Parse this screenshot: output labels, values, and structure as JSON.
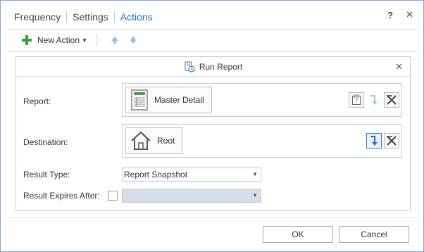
{
  "tabs": [
    {
      "label": "Frequency",
      "active": false
    },
    {
      "label": "Settings",
      "active": false
    },
    {
      "label": "Actions",
      "active": true
    }
  ],
  "title_controls": {
    "help": "?",
    "close": "✕"
  },
  "toolbar": {
    "new_action_label": "New Action"
  },
  "panel": {
    "title": "Run Report",
    "close": "✕",
    "report": {
      "label": "Report:",
      "value": "Master Detail"
    },
    "destination": {
      "label": "Destination:",
      "value": "Root"
    },
    "result_type": {
      "label": "Result Type:",
      "value": "Report Snapshot"
    },
    "result_expires": {
      "label": "Result Expires After:",
      "checked": false,
      "value": ""
    }
  },
  "footer": {
    "ok_label": "OK",
    "cancel_label": "Cancel"
  },
  "colors": {
    "accent": "#1f6fb4",
    "add_green": "#3e9a3e",
    "border_blue": "#7aa7d6"
  }
}
